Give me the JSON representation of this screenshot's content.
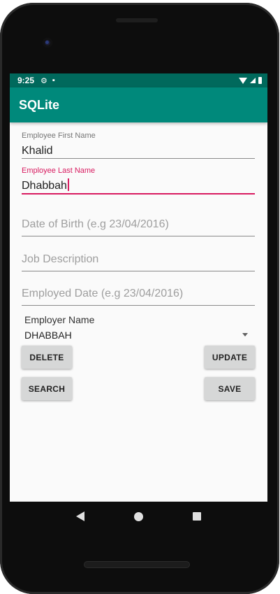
{
  "status_bar": {
    "time": "9:25",
    "icons": [
      "gear-icon",
      "sd-card-icon",
      "wifi-icon",
      "signal-icon",
      "battery-icon"
    ]
  },
  "app_bar": {
    "title": "SQLite"
  },
  "form": {
    "first_name": {
      "label": "Employee First Name",
      "value": "Khalid"
    },
    "last_name": {
      "label": "Employee Last Name",
      "value": "Dhabbah",
      "focused": true
    },
    "date_of_birth": {
      "placeholder": "Date of Birth (e.g 23/04/2016)"
    },
    "job_description": {
      "placeholder": "Job Description"
    },
    "employed_date": {
      "placeholder": "Employed Date (e.g 23/04/2016)"
    },
    "employer": {
      "label": "Employer Name",
      "selected": "DHABBAH"
    }
  },
  "buttons": {
    "delete": "DELETE",
    "update": "UPDATE",
    "search": "SEARCH",
    "save": "SAVE"
  },
  "navigation": {
    "icons": [
      "back-icon",
      "home-icon",
      "recents-icon"
    ]
  },
  "colors": {
    "status_bar": "#00695c",
    "app_bar": "#00897b",
    "accent": "#d81b60"
  }
}
